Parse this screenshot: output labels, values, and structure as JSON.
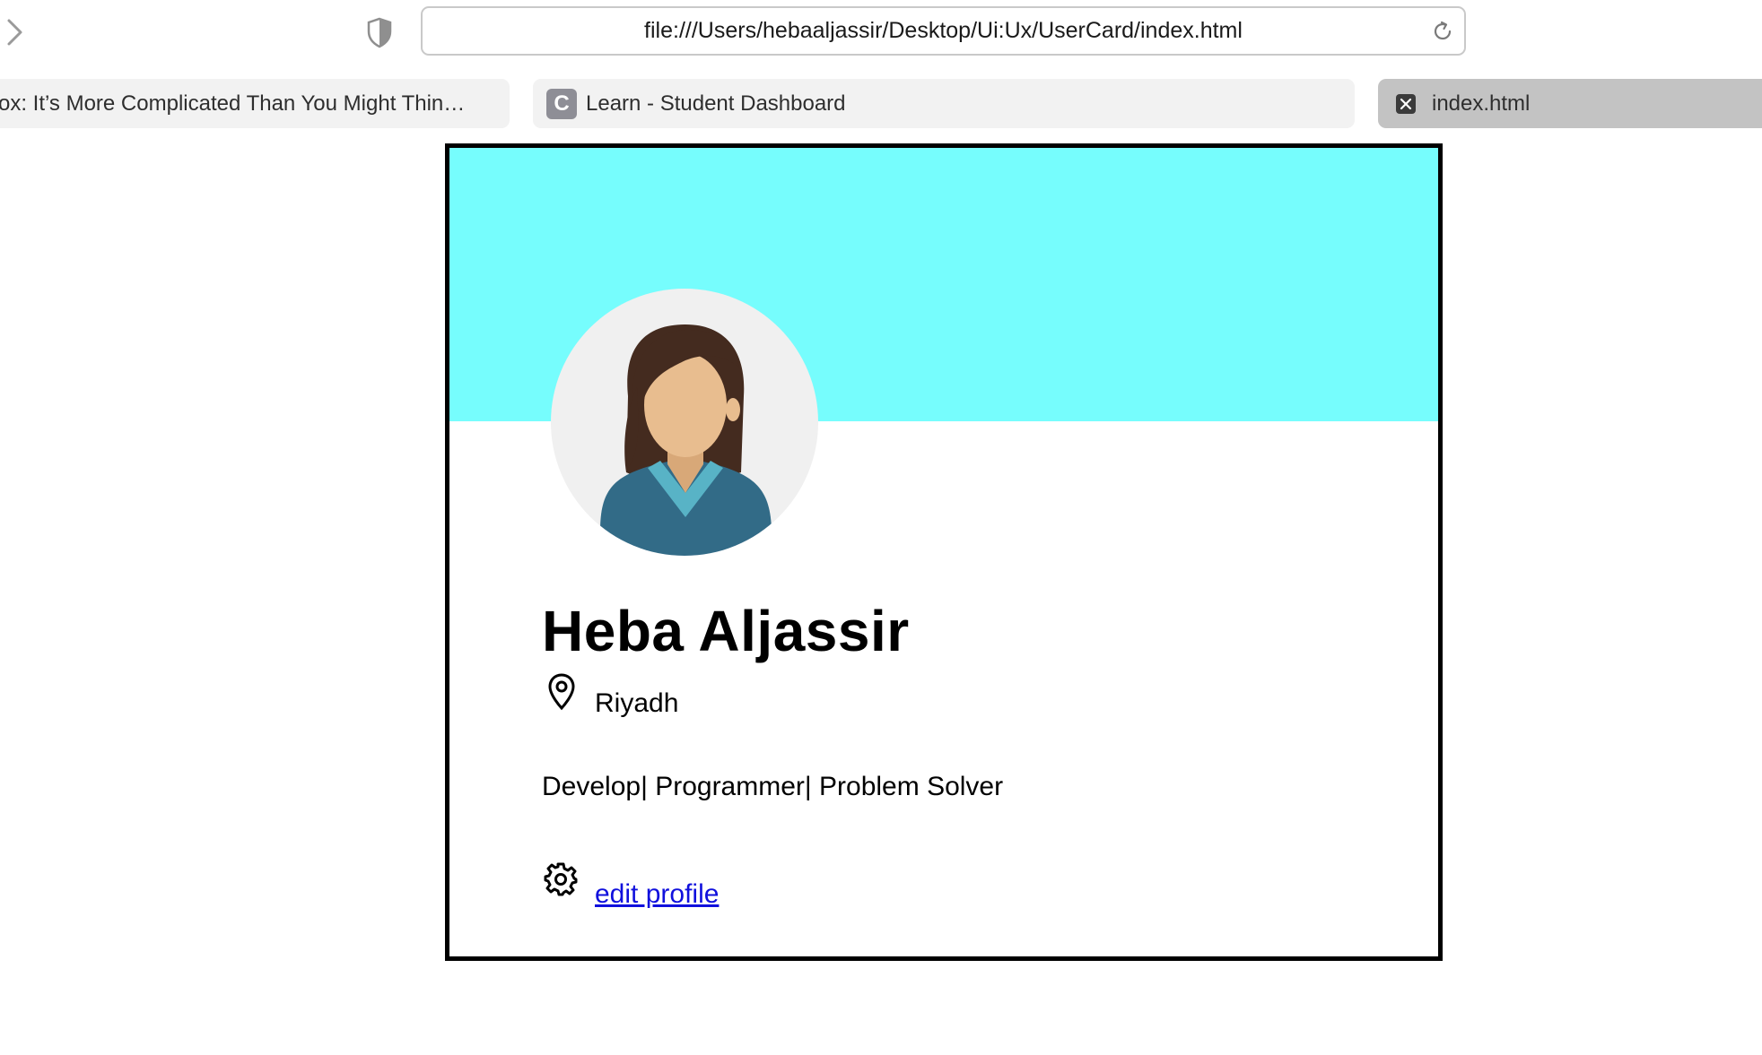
{
  "browser": {
    "url": "file:///Users/hebaaljassir/Desktop/Ui:Ux/UserCard/index.html",
    "tabs": [
      {
        "label": "ox: It’s More Complicated Than You Might Thin…"
      },
      {
        "label": "Learn - Student Dashboard",
        "favicon_letter": "C"
      },
      {
        "label": "index.html",
        "active": true
      }
    ]
  },
  "card": {
    "banner_color": "#76fdfd",
    "name": "Heba Aljassir",
    "location": "Riyadh",
    "bio": "Develop| Programmer| Problem Solver",
    "edit_label": "edit profile"
  }
}
